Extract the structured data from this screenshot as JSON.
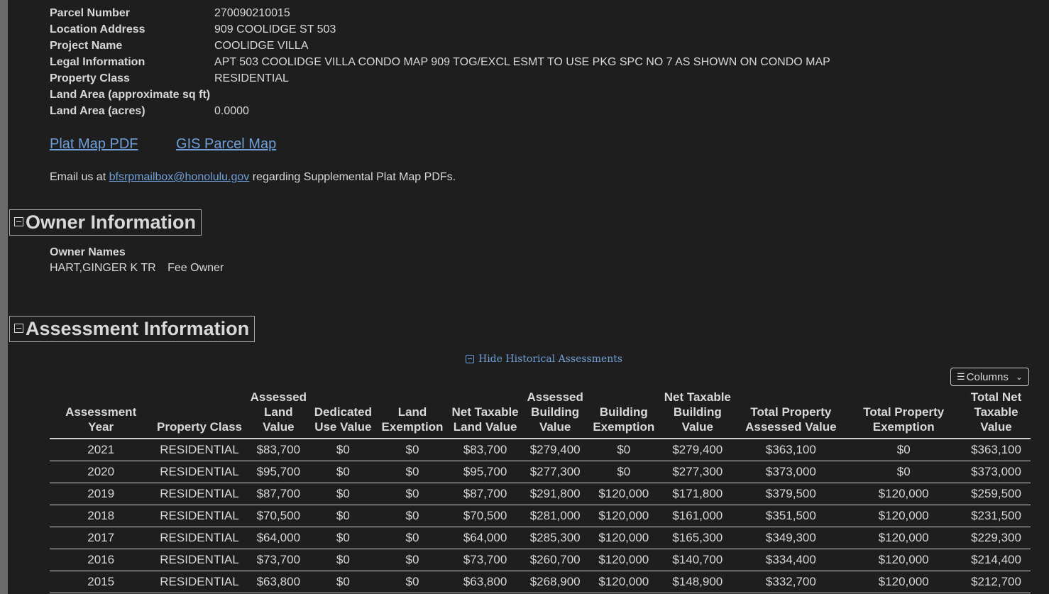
{
  "parcel_info": [
    {
      "label": "Parcel Number",
      "value": "270090210015"
    },
    {
      "label": "Location Address",
      "value": "909 COOLIDGE ST 503"
    },
    {
      "label": "Project Name",
      "value": "COOLIDGE VILLA"
    },
    {
      "label": "Legal Information",
      "value": "APT 503 COOLIDGE VILLA CONDO MAP 909 TOG/EXCL ESMT TO USE PKG SPC NO 7 AS SHOWN ON CONDO MAP"
    },
    {
      "label": "Property Class",
      "value": "RESIDENTIAL"
    },
    {
      "label": "Land Area (approximate sq ft)",
      "value": ""
    },
    {
      "label": "Land Area (acres)",
      "value": "0.0000"
    }
  ],
  "links": {
    "plat_map": "Plat Map PDF",
    "gis_map": "GIS Parcel Map"
  },
  "email": {
    "prefix": "Email us at ",
    "address": "bfsrpmailbox@honolulu.gov",
    "suffix": " regarding Supplemental Plat Map PDFs."
  },
  "owner_section": {
    "title": "Owner Information",
    "names_label": "Owner Names",
    "owners": [
      {
        "name": "HART,GINGER K TR",
        "type": "Fee Owner"
      }
    ]
  },
  "assessment_section": {
    "title": "Assessment Information",
    "hide_historical": "Hide Historical Assessments",
    "columns_button": "Columns",
    "columns": [
      "Assessment Year",
      "Property Class",
      "Assessed Land Value",
      "Dedicated Use Value",
      "Land Exemption",
      "Net Taxable Land Value",
      "Assessed Building Value",
      "Building Exemption",
      "Net Taxable Building Value",
      "Total Property Assessed Value",
      "Total Property Exemption",
      "Total Net Taxable Value"
    ],
    "rows": [
      [
        "2021",
        "RESIDENTIAL",
        "$83,700",
        "$0",
        "$0",
        "$83,700",
        "$279,400",
        "$0",
        "$279,400",
        "$363,100",
        "$0",
        "$363,100"
      ],
      [
        "2020",
        "RESIDENTIAL",
        "$95,700",
        "$0",
        "$0",
        "$95,700",
        "$277,300",
        "$0",
        "$277,300",
        "$373,000",
        "$0",
        "$373,000"
      ],
      [
        "2019",
        "RESIDENTIAL",
        "$87,700",
        "$0",
        "$0",
        "$87,700",
        "$291,800",
        "$120,000",
        "$171,800",
        "$379,500",
        "$120,000",
        "$259,500"
      ],
      [
        "2018",
        "RESIDENTIAL",
        "$70,500",
        "$0",
        "$0",
        "$70,500",
        "$281,000",
        "$120,000",
        "$161,000",
        "$351,500",
        "$120,000",
        "$231,500"
      ],
      [
        "2017",
        "RESIDENTIAL",
        "$64,000",
        "$0",
        "$0",
        "$64,000",
        "$285,300",
        "$120,000",
        "$165,300",
        "$349,300",
        "$120,000",
        "$229,300"
      ],
      [
        "2016",
        "RESIDENTIAL",
        "$73,700",
        "$0",
        "$0",
        "$73,700",
        "$260,700",
        "$120,000",
        "$140,700",
        "$334,400",
        "$120,000",
        "$214,400"
      ],
      [
        "2015",
        "RESIDENTIAL",
        "$63,800",
        "$0",
        "$0",
        "$63,800",
        "$268,900",
        "$120,000",
        "$148,900",
        "$332,700",
        "$120,000",
        "$212,700"
      ]
    ]
  },
  "colors": {
    "background": "#1e1e1e",
    "text": "#d8d8d8",
    "link": "#6f9fd8"
  }
}
